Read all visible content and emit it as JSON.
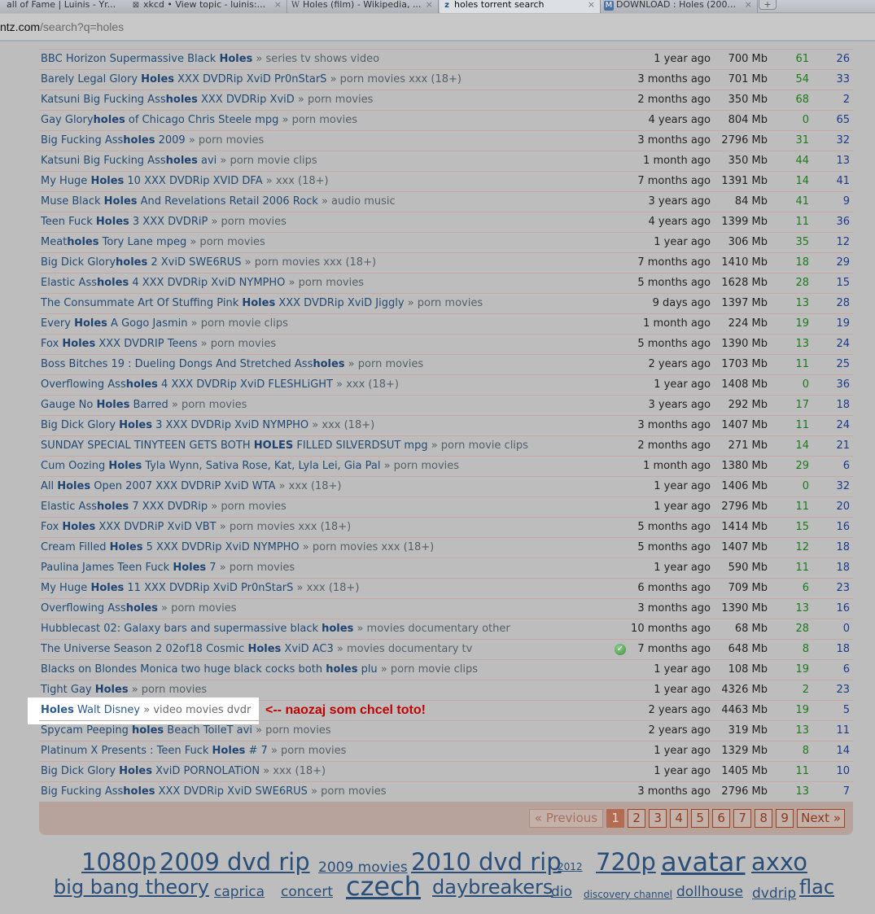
{
  "browser": {
    "tabs": [
      {
        "label": "all of Fame | Luinis - Yr...",
        "icon": "page-icon",
        "active": false
      },
      {
        "label": "xkcd • View topic - luinis:...",
        "icon": "xkcd-icon",
        "active": false
      },
      {
        "label": "Holes (film) - Wikipedia, ...",
        "icon": "wikipedia-icon",
        "active": false
      },
      {
        "label": "holes torrent search",
        "icon": "torrentz-icon",
        "active": true
      },
      {
        "label": "DOWNLOAD : Holes (200...",
        "icon": "m-icon",
        "active": false
      }
    ],
    "close_glyph": "×",
    "new_tab_glyph": "+",
    "url_host": "ntz.com",
    "url_path": "/search?q=holes"
  },
  "results": [
    {
      "pre": "BBC Horizon Supermassive Black ",
      "hl": "Holes",
      "post": "",
      "cat": "series tv shows video",
      "age": "1 year ago",
      "size": "700 Mb",
      "seeds": "61",
      "leech": "26"
    },
    {
      "pre": "Barely Legal Glory ",
      "hl": "Holes",
      "post": " XXX DVDRip XviD Pr0nStarS",
      "cat": "porn movies xxx (18+)",
      "age": "3 months ago",
      "size": "701 Mb",
      "seeds": "54",
      "leech": "33"
    },
    {
      "pre": "Katsuni Big Fucking Ass",
      "hl": "holes",
      "post": " XXX DVDRip XviD",
      "cat": "porn movies",
      "age": "2 months ago",
      "size": "350 Mb",
      "seeds": "68",
      "leech": "2"
    },
    {
      "pre": "Gay Glory",
      "hl": "holes",
      "post": " of Chicago Chris Steele mpg",
      "cat": "porn movies",
      "age": "4 years ago",
      "size": "804 Mb",
      "seeds": "0",
      "leech": "65"
    },
    {
      "pre": "Big Fucking Ass",
      "hl": "holes",
      "post": " 2009",
      "cat": "porn movies",
      "age": "3 months ago",
      "size": "2796 Mb",
      "seeds": "31",
      "leech": "32"
    },
    {
      "pre": "Katsuni Big Fucking Ass",
      "hl": "holes",
      "post": " avi",
      "cat": "porn movie clips",
      "age": "1 month ago",
      "size": "350 Mb",
      "seeds": "44",
      "leech": "13"
    },
    {
      "pre": "My Huge ",
      "hl": "Holes",
      "post": " 10 XXX DVDRip XVID DFA",
      "cat": "xxx (18+)",
      "age": "7 months ago",
      "size": "1391 Mb",
      "seeds": "14",
      "leech": "41"
    },
    {
      "pre": "Muse Black ",
      "hl": "Holes",
      "post": " And Revelations Retail 2006 Rock",
      "cat": "audio music",
      "age": "3 years ago",
      "size": "84 Mb",
      "seeds": "41",
      "leech": "9"
    },
    {
      "pre": "Teen Fuck ",
      "hl": "Holes",
      "post": " 3 XXX DVDRiP",
      "cat": "porn movies",
      "age": "4 years ago",
      "size": "1399 Mb",
      "seeds": "11",
      "leech": "36"
    },
    {
      "pre": "Meat",
      "hl": "holes",
      "post": " Tory Lane mpeg",
      "cat": "porn movies",
      "age": "1 year ago",
      "size": "306 Mb",
      "seeds": "35",
      "leech": "12"
    },
    {
      "pre": "Big Dick Glory",
      "hl": "holes",
      "post": " 2 XviD SWE6RUS",
      "cat": "porn movies xxx (18+)",
      "age": "7 months ago",
      "size": "1410 Mb",
      "seeds": "18",
      "leech": "29"
    },
    {
      "pre": "Elastic Ass",
      "hl": "holes",
      "post": " 4 XXX DVDRip XviD NYMPHO",
      "cat": "porn movies",
      "age": "5 months ago",
      "size": "1628 Mb",
      "seeds": "28",
      "leech": "15"
    },
    {
      "pre": "The Consummate Art Of Stuffing Pink ",
      "hl": "Holes",
      "post": " XXX DVDRip XviD Jiggly",
      "cat": "porn movies",
      "age": "9 days ago",
      "size": "1397 Mb",
      "seeds": "13",
      "leech": "28"
    },
    {
      "pre": "Every ",
      "hl": "Holes",
      "post": " A Gogo Jasmin",
      "cat": "porn movie clips",
      "age": "1 month ago",
      "size": "224 Mb",
      "seeds": "19",
      "leech": "19"
    },
    {
      "pre": "Fox ",
      "hl": "Holes",
      "post": " XXX DVDRIP Teens",
      "cat": "porn movies",
      "age": "5 months ago",
      "size": "1390 Mb",
      "seeds": "13",
      "leech": "24"
    },
    {
      "pre": "Boss Bitches 19 : Dueling Dongs And Stretched Ass",
      "hl": "holes",
      "post": "",
      "cat": "porn movies",
      "age": "2 years ago",
      "size": "1703 Mb",
      "seeds": "11",
      "leech": "25"
    },
    {
      "pre": "Overflowing Ass",
      "hl": "holes",
      "post": " 4 XXX DVDRip XviD FLESHLiGHT",
      "cat": "xxx (18+)",
      "age": "1 year ago",
      "size": "1408 Mb",
      "seeds": "0",
      "leech": "36"
    },
    {
      "pre": "Gauge No ",
      "hl": "Holes",
      "post": " Barred",
      "cat": "porn movies",
      "age": "3 years ago",
      "size": "292 Mb",
      "seeds": "17",
      "leech": "18"
    },
    {
      "pre": "Big Dick Glory ",
      "hl": "Holes",
      "post": " 3 XXX DVDRip XviD NYMPHO",
      "cat": "xxx (18+)",
      "age": "3 months ago",
      "size": "1407 Mb",
      "seeds": "11",
      "leech": "24"
    },
    {
      "pre": "SUNDAY SPECIAL TINYTEEN GETS BOTH ",
      "hl": "HOLES",
      "post": " FILLED SILVERDSUT mpg",
      "cat": "porn movie clips",
      "age": "2 months ago",
      "size": "271 Mb",
      "seeds": "14",
      "leech": "21"
    },
    {
      "pre": "Cum Oozing ",
      "hl": "Holes",
      "post": " Tyla Wynn, Sativa Rose, Kat, Lyla Lei, Gia Pal",
      "cat": "porn movies",
      "age": "1 month ago",
      "size": "1380 Mb",
      "seeds": "29",
      "leech": "6"
    },
    {
      "pre": "All ",
      "hl": "Holes",
      "post": " Open 2007 XXX DVDRiP XviD WTA",
      "cat": "xxx (18+)",
      "age": "1 year ago",
      "size": "1406 Mb",
      "seeds": "0",
      "leech": "32"
    },
    {
      "pre": "Elastic Ass",
      "hl": "holes",
      "post": " 7 XXX DVDRip",
      "cat": "porn movies",
      "age": "1 year ago",
      "size": "2796 Mb",
      "seeds": "11",
      "leech": "20"
    },
    {
      "pre": "Fox ",
      "hl": "Holes",
      "post": " XXX DVDRiP XviD VBT",
      "cat": "porn movies xxx (18+)",
      "age": "5 months ago",
      "size": "1414 Mb",
      "seeds": "15",
      "leech": "16"
    },
    {
      "pre": "Cream Filled ",
      "hl": "Holes",
      "post": " 5 XXX DVDRip XviD NYMPHO",
      "cat": "porn movies xxx (18+)",
      "age": "5 months ago",
      "size": "1407 Mb",
      "seeds": "12",
      "leech": "18"
    },
    {
      "pre": "Paulina James Teen Fuck ",
      "hl": "Holes",
      "post": " 7",
      "cat": "porn movies",
      "age": "1 year ago",
      "size": "590 Mb",
      "seeds": "11",
      "leech": "18"
    },
    {
      "pre": "My Huge ",
      "hl": "Holes",
      "post": " 11 XXX DVDRip XviD Pr0nStarS",
      "cat": "xxx (18+)",
      "age": "6 months ago",
      "size": "709 Mb",
      "seeds": "6",
      "leech": "23"
    },
    {
      "pre": "Overflowing Ass",
      "hl": "holes",
      "post": "",
      "cat": "porn movies",
      "age": "3 months ago",
      "size": "1390 Mb",
      "seeds": "13",
      "leech": "16"
    },
    {
      "pre": "Hubblecast 02: Galaxy bars and supermassive black ",
      "hl": "holes",
      "post": "",
      "cat": "movies documentary other",
      "age": "10 months ago",
      "size": "68 Mb",
      "seeds": "28",
      "leech": "0"
    },
    {
      "pre": "The Universe Season 2 02of18 Cosmic ",
      "hl": "Holes",
      "post": " XviD AC3",
      "cat": "movies documentary tv",
      "age": "7 months ago",
      "size": "648 Mb",
      "seeds": "8",
      "leech": "18",
      "verified": true
    },
    {
      "pre": "Blacks on Blondes Monica two huge black cocks both ",
      "hl": "holes",
      "post": " plu",
      "cat": "porn movie clips",
      "age": "1 year ago",
      "size": "108 Mb",
      "seeds": "19",
      "leech": "6"
    },
    {
      "pre": "Tight Gay ",
      "hl": "Holes",
      "post": "",
      "cat": "porn movies",
      "age": "1 year ago",
      "size": "4326 Mb",
      "seeds": "2",
      "leech": "23"
    },
    {
      "pre": "",
      "hl": "Holes",
      "post": " Walt Disney",
      "cat": "video movies dvdr",
      "age": "2 years ago",
      "size": "4463 Mb",
      "seeds": "19",
      "leech": "5",
      "highlighted": true,
      "annotation": "<-- naozaj som chcel  toto!"
    },
    {
      "pre": "Spycam Peeping ",
      "hl": "holes",
      "post": " Beach ToileT avi",
      "cat": "porn movies",
      "age": "2 years ago",
      "size": "319 Mb",
      "seeds": "13",
      "leech": "11"
    },
    {
      "pre": "Platinum X Presents : Teen Fuck ",
      "hl": "Holes",
      "post": " # 7",
      "cat": "porn movies",
      "age": "1 year ago",
      "size": "1329 Mb",
      "seeds": "8",
      "leech": "14"
    },
    {
      "pre": "Big Dick Glory ",
      "hl": "Holes",
      "post": " XviD PORNOLATiON",
      "cat": "xxx (18+)",
      "age": "1 year ago",
      "size": "1405 Mb",
      "seeds": "11",
      "leech": "10"
    },
    {
      "pre": "Big Fucking Ass",
      "hl": "holes",
      "post": " XXX DVDRip XviD SWE6RUS",
      "cat": "porn movies",
      "age": "3 months ago",
      "size": "2796 Mb",
      "seeds": "13",
      "leech": "7"
    }
  ],
  "category_separator": " » ",
  "pagination": {
    "previous_label": "« Previous",
    "pages": [
      "1",
      "2",
      "3",
      "4",
      "5",
      "6",
      "7",
      "8",
      "9"
    ],
    "current_page": "1",
    "next_label": "Next »"
  },
  "tag_cloud": [
    [
      {
        "label": "1080p",
        "size": "l"
      },
      {
        "label": "2009 dvd rip",
        "size": "l"
      },
      {
        "label": "2009 movies",
        "size": "s"
      },
      {
        "label": "2010 dvd rip",
        "size": "l"
      },
      {
        "label": "2012",
        "size": "xs"
      },
      {
        "label": "720p",
        "size": "l"
      },
      {
        "label": "avatar",
        "size": "xl"
      },
      {
        "label": "axxo",
        "size": "l"
      }
    ],
    [
      {
        "label": "big bang theory",
        "size": "m"
      },
      {
        "label": "caprica",
        "size": "s"
      },
      {
        "label": "concert",
        "size": "s"
      },
      {
        "label": "czech",
        "size": "xl"
      },
      {
        "label": "daybreakers",
        "size": "m"
      },
      {
        "label": "dio",
        "size": "s"
      },
      {
        "label": "discovery channel",
        "size": "xs"
      },
      {
        "label": "dollhouse",
        "size": "s"
      },
      {
        "label": "dvdrip",
        "size": "s"
      },
      {
        "label": "flac",
        "size": "m"
      }
    ]
  ]
}
